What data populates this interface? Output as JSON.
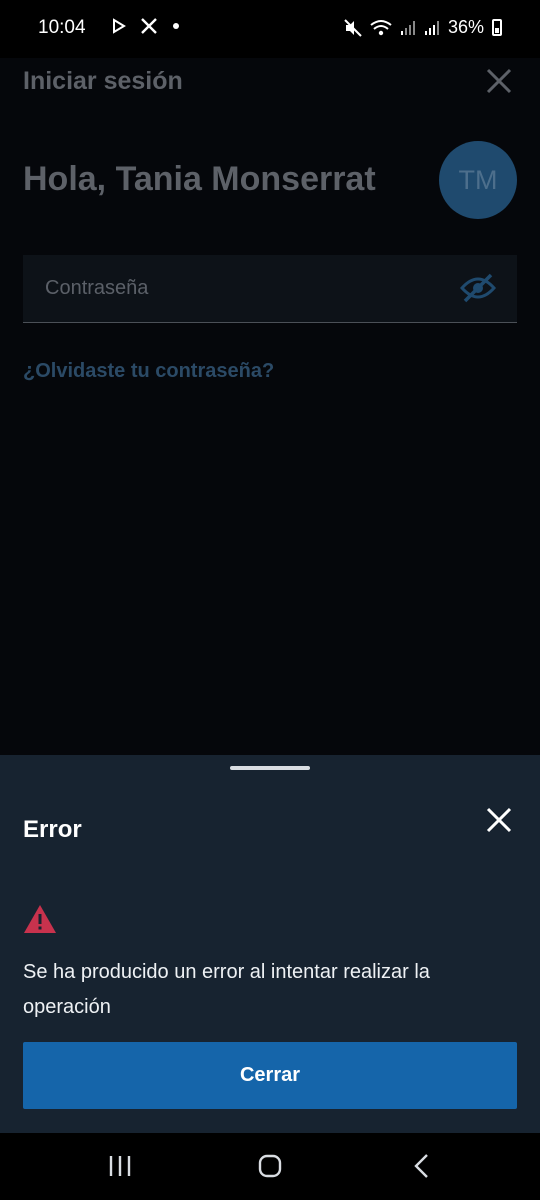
{
  "status_bar": {
    "time": "10:04",
    "battery": "36%",
    "icons": [
      "media-play-icon",
      "x-logo-icon",
      "dot-icon",
      "mute-icon",
      "wifi-icon",
      "signal-icon",
      "signal-icon",
      "battery-icon"
    ]
  },
  "login": {
    "title": "Iniciar sesión",
    "greeting": "Hola, Tania Monserrat",
    "avatar_initials": "TM",
    "password_placeholder": "Contraseña",
    "password_value": "",
    "forgot_link": "¿Olvidaste tu contraseña?"
  },
  "error_sheet": {
    "title": "Error",
    "message": "Se ha producido un error al intentar realizar la operación",
    "button_label": "Cerrar"
  },
  "colors": {
    "sheet_bg": "#172330",
    "primary_button": "#1565aa",
    "warning": "#c8324d",
    "link": "#2b4a66"
  }
}
